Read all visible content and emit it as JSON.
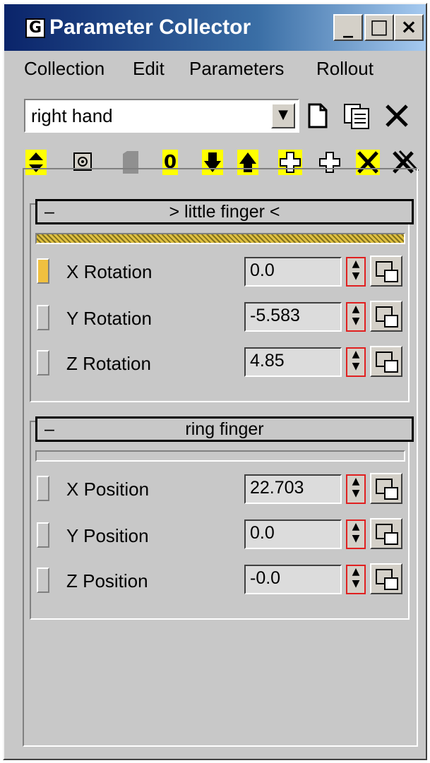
{
  "window": {
    "title": "Parameter Collector",
    "app_icon": "G",
    "minimize_glyph": "_",
    "maximize_glyph": "□",
    "close_glyph": "×"
  },
  "menu": [
    "Collection",
    "Edit",
    "Parameters",
    "Rollout"
  ],
  "collection": {
    "selected": "right hand",
    "dropdown_arrow": "▼",
    "new_icon": "new-document-icon",
    "duplicate_icon": "duplicate-icon",
    "delete_icon": "delete-icon"
  },
  "toolbar": {
    "zero_label": "0",
    "icons": [
      "select-multiple-icon",
      "select-icon",
      "gray-square-icon",
      "zero-icon",
      "move-down-icon",
      "move-up-icon",
      "add-selected-icon",
      "add-icon",
      "remove-icon",
      "remove-all-icon"
    ]
  },
  "rollouts": [
    {
      "minus": "–",
      "title": "> little finger <",
      "active": true,
      "params": [
        {
          "label": "X Rotation",
          "value": "0.0",
          "selected": true
        },
        {
          "label": "Y Rotation",
          "value": "-5.583",
          "selected": false
        },
        {
          "label": "Z Rotation",
          "value": "4.85",
          "selected": false
        }
      ]
    },
    {
      "minus": "–",
      "title": "ring finger",
      "active": false,
      "params": [
        {
          "label": "X Position",
          "value": "22.703",
          "selected": false
        },
        {
          "label": "Y Position",
          "value": "0.0",
          "selected": false
        },
        {
          "label": "Z Position",
          "value": "-0.0",
          "selected": false
        }
      ]
    }
  ],
  "colors": {
    "title_bar_start": "#0a246a",
    "title_bar_end": "#a6caf0",
    "panel_bg": "#c8c8c8",
    "highlight_yellow": "#ffff00",
    "marker_selected": "#f0c040",
    "spinner_border": "#e02020"
  }
}
